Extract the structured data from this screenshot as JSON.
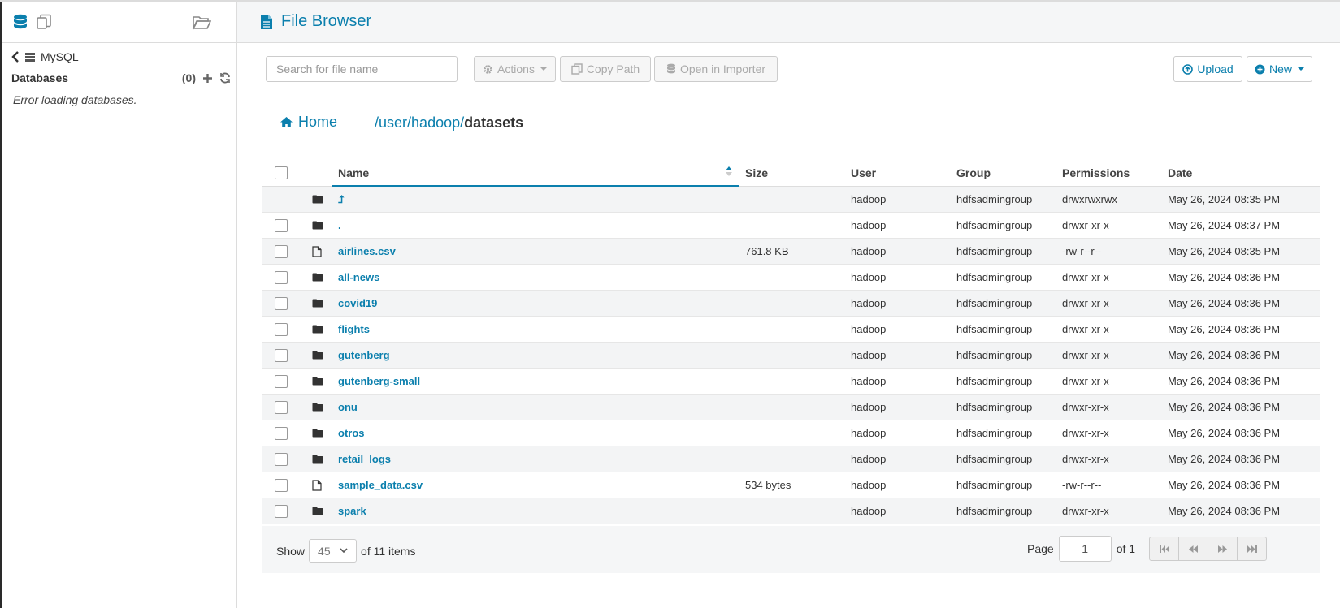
{
  "sidebar": {
    "back_label": "MySQL",
    "databases_title": "Databases",
    "databases_count": "(0)",
    "error_text": "Error loading databases."
  },
  "header": {
    "title": "File Browser"
  },
  "toolbar": {
    "search_placeholder": "Search for file name",
    "actions_label": "Actions",
    "copy_path_label": "Copy Path",
    "open_importer_label": "Open in Importer",
    "upload_label": "Upload",
    "new_label": "New"
  },
  "breadcrumb": {
    "home_label": "Home",
    "parts": [
      "/",
      "user",
      "/",
      "hadoop",
      "/"
    ],
    "current": "datasets"
  },
  "table": {
    "columns": [
      "Name",
      "Size",
      "User",
      "Group",
      "Permissions",
      "Date"
    ],
    "rows": [
      {
        "type": "folder",
        "name": "⮥",
        "size": "",
        "user": "hadoop",
        "group": "hdfsadmingroup",
        "perm": "drwxrwxrwx",
        "date": "May 26, 2024 08:35 PM",
        "checkbox": false
      },
      {
        "type": "folder",
        "name": ".",
        "size": "",
        "user": "hadoop",
        "group": "hdfsadmingroup",
        "perm": "drwxr-xr-x",
        "date": "May 26, 2024 08:37 PM",
        "checkbox": true
      },
      {
        "type": "file",
        "name": "airlines.csv",
        "size": "761.8 KB",
        "user": "hadoop",
        "group": "hdfsadmingroup",
        "perm": "-rw-r--r--",
        "date": "May 26, 2024 08:35 PM",
        "checkbox": true
      },
      {
        "type": "folder",
        "name": "all-news",
        "size": "",
        "user": "hadoop",
        "group": "hdfsadmingroup",
        "perm": "drwxr-xr-x",
        "date": "May 26, 2024 08:36 PM",
        "checkbox": true
      },
      {
        "type": "folder",
        "name": "covid19",
        "size": "",
        "user": "hadoop",
        "group": "hdfsadmingroup",
        "perm": "drwxr-xr-x",
        "date": "May 26, 2024 08:36 PM",
        "checkbox": true
      },
      {
        "type": "folder",
        "name": "flights",
        "size": "",
        "user": "hadoop",
        "group": "hdfsadmingroup",
        "perm": "drwxr-xr-x",
        "date": "May 26, 2024 08:36 PM",
        "checkbox": true
      },
      {
        "type": "folder",
        "name": "gutenberg",
        "size": "",
        "user": "hadoop",
        "group": "hdfsadmingroup",
        "perm": "drwxr-xr-x",
        "date": "May 26, 2024 08:36 PM",
        "checkbox": true
      },
      {
        "type": "folder",
        "name": "gutenberg-small",
        "size": "",
        "user": "hadoop",
        "group": "hdfsadmingroup",
        "perm": "drwxr-xr-x",
        "date": "May 26, 2024 08:36 PM",
        "checkbox": true
      },
      {
        "type": "folder",
        "name": "onu",
        "size": "",
        "user": "hadoop",
        "group": "hdfsadmingroup",
        "perm": "drwxr-xr-x",
        "date": "May 26, 2024 08:36 PM",
        "checkbox": true
      },
      {
        "type": "folder",
        "name": "otros",
        "size": "",
        "user": "hadoop",
        "group": "hdfsadmingroup",
        "perm": "drwxr-xr-x",
        "date": "May 26, 2024 08:36 PM",
        "checkbox": true
      },
      {
        "type": "folder",
        "name": "retail_logs",
        "size": "",
        "user": "hadoop",
        "group": "hdfsadmingroup",
        "perm": "drwxr-xr-x",
        "date": "May 26, 2024 08:36 PM",
        "checkbox": true
      },
      {
        "type": "file",
        "name": "sample_data.csv",
        "size": "534 bytes",
        "user": "hadoop",
        "group": "hdfsadmingroup",
        "perm": "-rw-r--r--",
        "date": "May 26, 2024 08:36 PM",
        "checkbox": true
      },
      {
        "type": "folder",
        "name": "spark",
        "size": "",
        "user": "hadoop",
        "group": "hdfsadmingroup",
        "perm": "drwxr-xr-x",
        "date": "May 26, 2024 08:36 PM",
        "checkbox": true
      }
    ]
  },
  "footer": {
    "show_label": "Show",
    "page_size": "45",
    "items_text": "of 11 items",
    "page_label": "Page",
    "page_value": "1",
    "page_of": "of 1"
  },
  "colors": {
    "accent": "#0b7fad",
    "row_alt": "#f3f4f5",
    "header_bg": "#f5f6f7"
  },
  "icons": [
    "database-icon",
    "copy-icon",
    "folder-open-icon",
    "chevron-left-icon",
    "server-icon",
    "plus-icon",
    "refresh-icon",
    "file-text-icon",
    "gear-icon",
    "copy-icon",
    "database-icon",
    "upload-icon",
    "plus-circle-icon",
    "home-icon",
    "folder-icon",
    "file-icon",
    "sort-icon",
    "first-page-icon",
    "prev-page-icon",
    "next-page-icon",
    "last-page-icon"
  ]
}
